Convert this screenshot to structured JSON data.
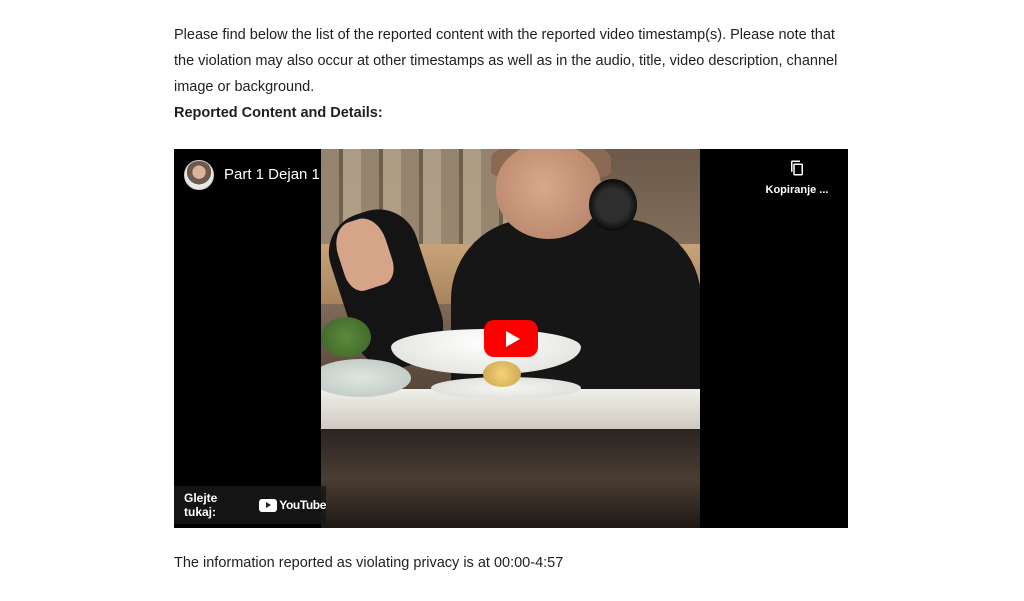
{
  "intro": {
    "paragraph": "Please find below the list of the reported content with the reported video timestamp(s). Please note that the violation may also occur at other timestamps as well as in the audio, title, video description, channel image or background.",
    "heading": "Reported Content and Details:"
  },
  "video": {
    "title": "Part 1 Dejan 1",
    "copy_label": "Kopiranje ...",
    "watch_on_label": "Glejte tukaj:",
    "platform_name": "YouTube",
    "play_button_color": "#ff0000",
    "icons": {
      "avatar": "channel-avatar",
      "copy": "copy-link-icon",
      "play": "play-icon",
      "logo": "youtube-logo-icon"
    }
  },
  "footer": {
    "timestamp_text": "The information reported as violating privacy is at 00:00-4:57"
  }
}
